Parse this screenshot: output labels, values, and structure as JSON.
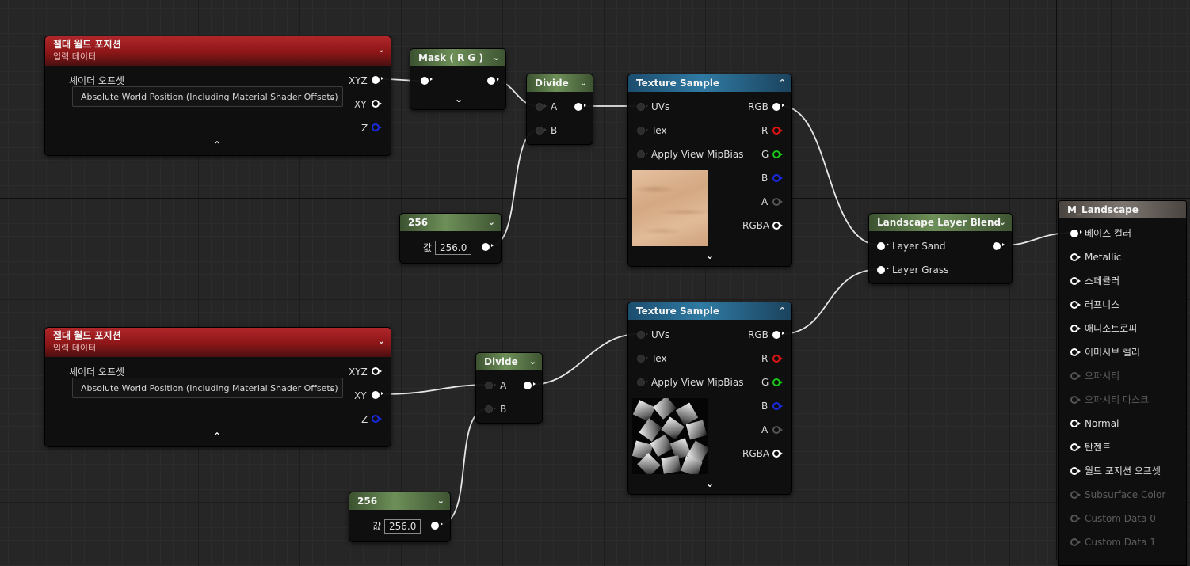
{
  "nodes": {
    "awp1": {
      "title": "절대 월드 포지션",
      "subtitle": "입력 데이터",
      "param_label": "셰이더 오프셋",
      "dropdown_value": "Absolute World Position (Including Material Shader Offsets)",
      "outputs": [
        "XYZ",
        "XY",
        "Z"
      ]
    },
    "awp2": {
      "title": "절대 월드 포지션",
      "subtitle": "입력 데이터",
      "param_label": "셰이더 오프셋",
      "dropdown_value": "Absolute World Position (Including Material Shader Offsets)",
      "outputs": [
        "XYZ",
        "XY",
        "Z"
      ]
    },
    "mask": {
      "title": "Mask ( R G )"
    },
    "divide1": {
      "title": "Divide",
      "inputs": [
        "A",
        "B"
      ]
    },
    "divide2": {
      "title": "Divide",
      "inputs": [
        "A",
        "B"
      ]
    },
    "const1": {
      "title": "256",
      "value_label": "값",
      "value": "256.0"
    },
    "const2": {
      "title": "256",
      "value_label": "값",
      "value": "256.0"
    },
    "tex1": {
      "title": "Texture Sample",
      "inputs": [
        "UVs",
        "Tex",
        "Apply View MipBias"
      ],
      "outputs": [
        "RGB",
        "R",
        "G",
        "B",
        "A",
        "RGBA"
      ]
    },
    "tex2": {
      "title": "Texture Sample",
      "inputs": [
        "UVs",
        "Tex",
        "Apply View MipBias"
      ],
      "outputs": [
        "RGB",
        "R",
        "G",
        "B",
        "A",
        "RGBA"
      ]
    },
    "blend": {
      "title": "Landscape Layer Blend",
      "layers": [
        "Layer Sand",
        "Layer Grass"
      ]
    },
    "material": {
      "title": "M_Landscape",
      "inputs": [
        "베이스 컬러",
        "Metallic",
        "스페큘러",
        "러프니스",
        "애니소트로피",
        "이미시브 컬러",
        "오파시티",
        "오파시티 마스크",
        "Normal",
        "탄젠트",
        "월드 포지션 오프셋",
        "Subsurface Color",
        "Custom Data 0",
        "Custom Data 1"
      ]
    }
  },
  "colors": {
    "header_red": "#9e1d20",
    "header_green": "#6d8f58",
    "header_blue": "#2f7aa3",
    "header_gray": "#7c7570",
    "pin_r": "#e01414",
    "pin_g": "#18c618",
    "pin_b": "#1a2ae0",
    "wire": "#e6e6e6"
  },
  "icons": {
    "collapse": "chevron-down-icon",
    "expand": "chevron-up-icon",
    "pin": "pin-circle-icon"
  }
}
